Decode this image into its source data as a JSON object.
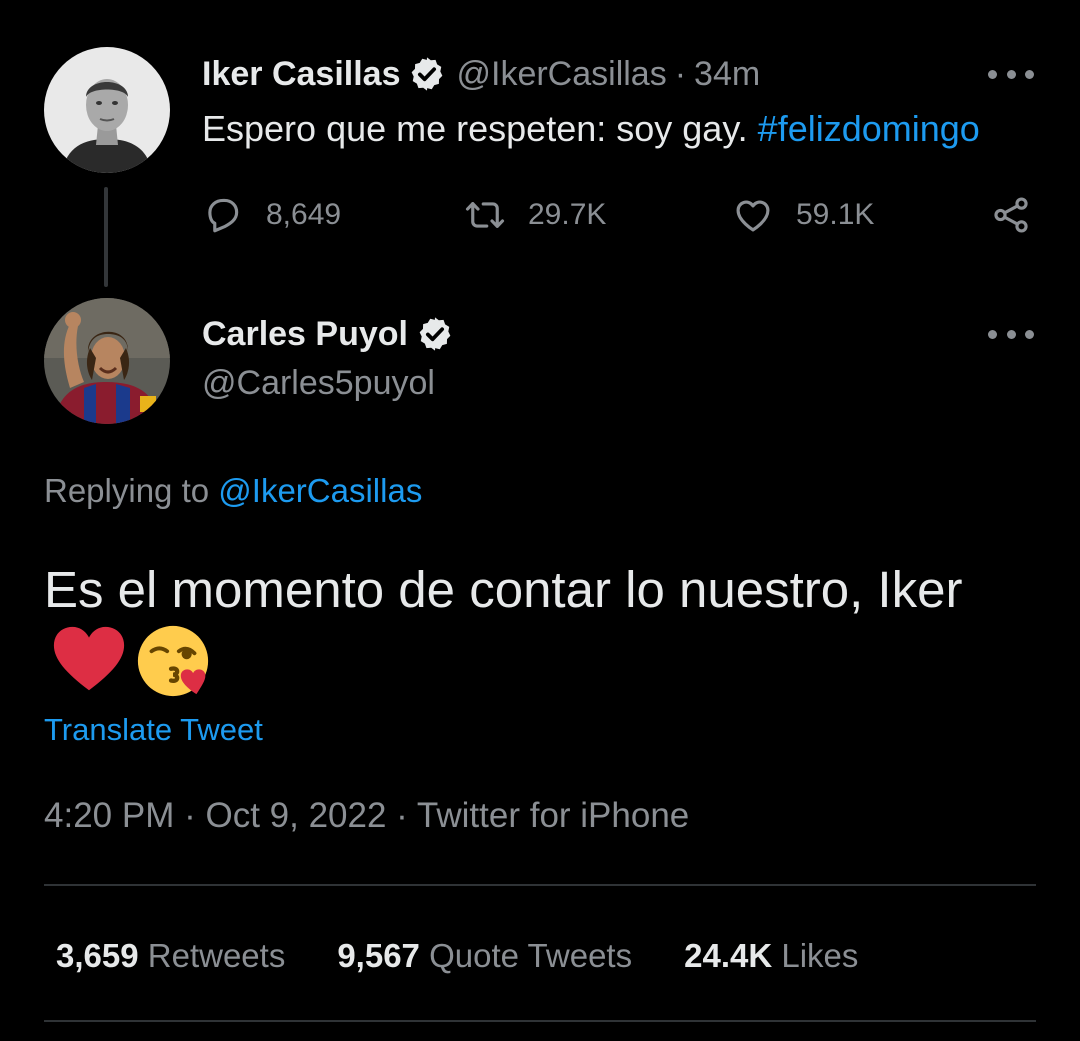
{
  "parent_tweet": {
    "display_name": "Iker Casillas",
    "handle": "@IkerCasillas",
    "separator": "·",
    "time": "34m",
    "text": "Espero que me respeten: soy gay.",
    "hashtag": "#felizdomingo",
    "actions": {
      "replies": "8,649",
      "retweets": "29.7K",
      "likes": "59.1K"
    },
    "icons": {
      "reply": "reply-icon",
      "retweet": "retweet-icon",
      "like": "heart-icon",
      "share": "share-icon",
      "more": "more-icon",
      "verified": "verified-badge-icon"
    }
  },
  "reply_tweet": {
    "display_name": "Carles Puyol",
    "handle": "@Carles5puyol",
    "replying_prefix": "Replying to",
    "replying_mention": "@IkerCasillas",
    "text": "Es el momento de contar lo nuestro, Iker",
    "emojis": [
      "heart-emoji",
      "kissing-face-emoji"
    ],
    "translate_label": "Translate Tweet",
    "time": "4:20 PM",
    "date": "Oct 9, 2022",
    "separator": "·",
    "source": "Twitter for iPhone",
    "stats": [
      {
        "count": "3,659",
        "label": "Retweets"
      },
      {
        "count": "9,567",
        "label": "Quote Tweets"
      },
      {
        "count": "24.4K",
        "label": "Likes"
      }
    ]
  },
  "colors": {
    "background": "#000000",
    "text_primary": "#e7e9ea",
    "text_secondary": "#8b8f94",
    "link": "#1d9bf0",
    "divider": "#2f3336"
  }
}
